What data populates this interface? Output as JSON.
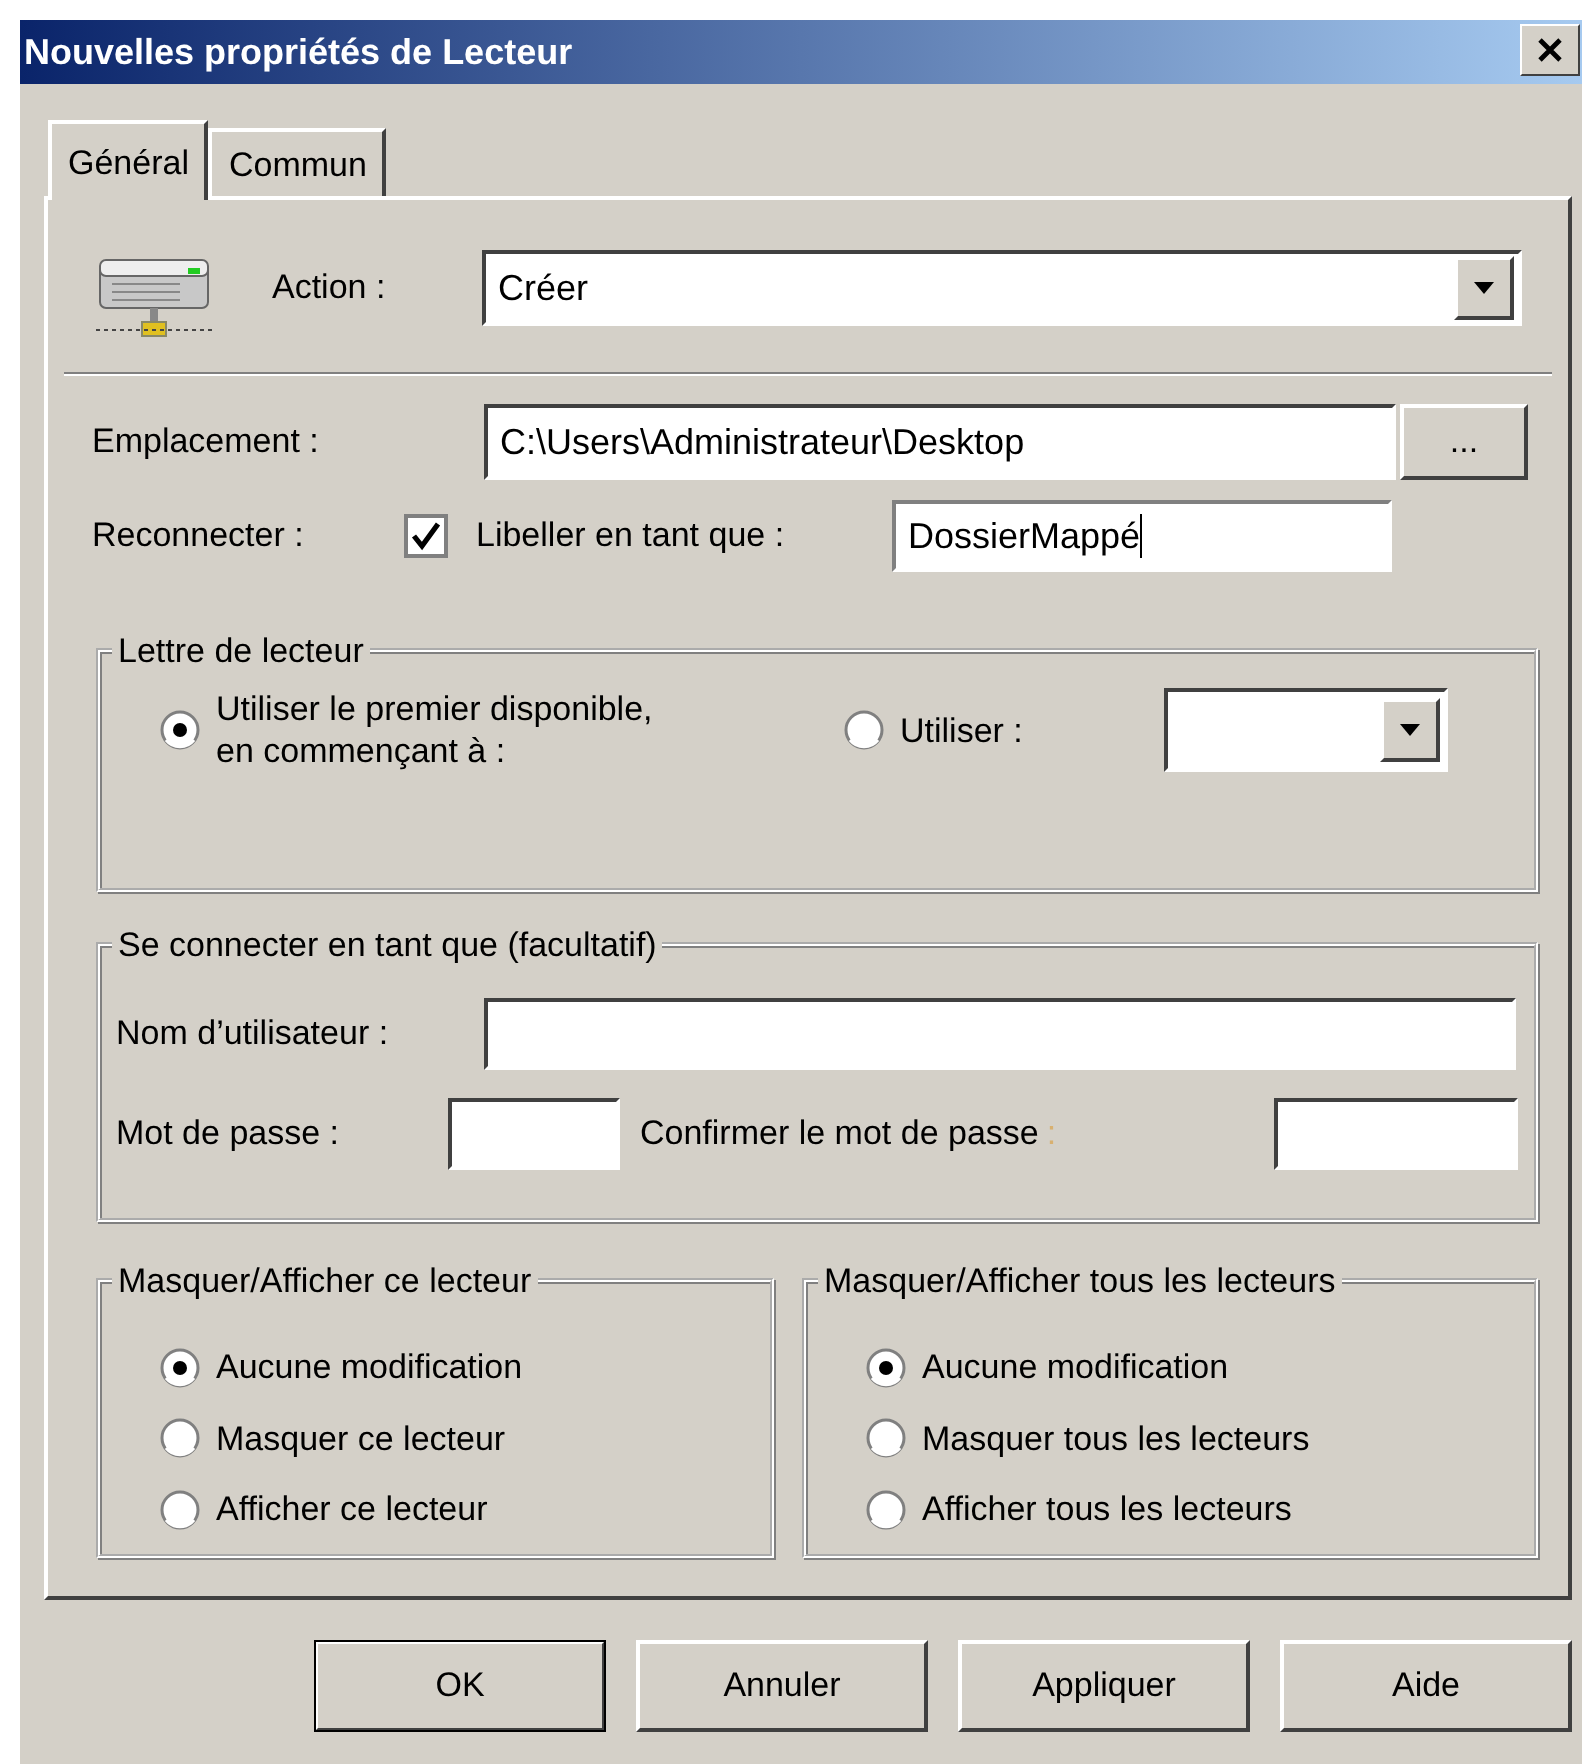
{
  "window": {
    "title": "Nouvelles propriétés de Lecteur"
  },
  "tabs": [
    {
      "label": "Général",
      "selected": true
    },
    {
      "label": "Commun",
      "selected": false
    }
  ],
  "action": {
    "label": "Action :",
    "value": "Créer"
  },
  "location": {
    "label": "Emplacement :",
    "value": "C:\\Users\\Administrateur\\Desktop",
    "browse": "..."
  },
  "reconnect": {
    "label": "Reconnecter :",
    "checked": true
  },
  "label_as": {
    "label": "Libeller en tant que :",
    "value": "DossierMappé",
    "focused": true
  },
  "drive_letter": {
    "title": "Lettre de lecteur",
    "options": [
      {
        "label": "Utiliser le premier disponible,\nen commençant à :",
        "selected": true
      },
      {
        "label": "Utiliser :",
        "selected": false
      }
    ]
  },
  "connect_as": {
    "title": "Se connecter en tant que (facultatif)",
    "username_label": "Nom d’utilisateur :",
    "password_label": "Mot de passe :",
    "confirm_label": "Confirmer le mot de passe",
    "confirm_colon": ":"
  },
  "hide_show_drive": {
    "title": "Masquer/Afficher ce lecteur",
    "options": [
      {
        "label": "Aucune modification",
        "selected": true
      },
      {
        "label": "Masquer ce lecteur",
        "selected": false
      },
      {
        "label": "Afficher ce lecteur",
        "selected": false
      }
    ]
  },
  "hide_show_all": {
    "title": "Masquer/Afficher tous les lecteurs",
    "options": [
      {
        "label": "Aucune modification",
        "selected": true
      },
      {
        "label": "Masquer tous les lecteurs",
        "selected": false
      },
      {
        "label": "Afficher tous les lecteurs",
        "selected": false
      }
    ]
  },
  "buttons": [
    {
      "label": "OK",
      "default": true
    },
    {
      "label": "Annuler",
      "default": false
    },
    {
      "label": "Appliquer",
      "default": false
    },
    {
      "label": "Aide",
      "default": false
    }
  ]
}
